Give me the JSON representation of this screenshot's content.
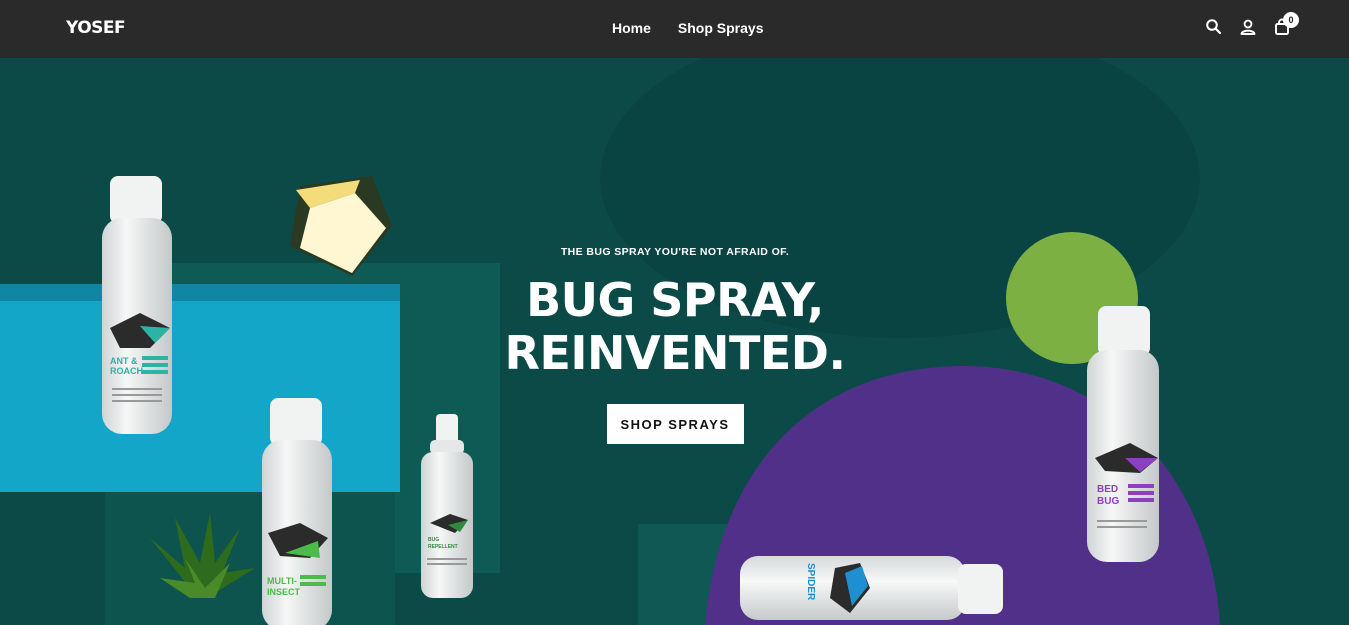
{
  "header": {
    "logo": "YOSEF",
    "nav": [
      {
        "label": "Home"
      },
      {
        "label": "Shop Sprays"
      }
    ],
    "cart_count": "0",
    "icons": [
      "search-icon",
      "account-icon",
      "cart-icon"
    ]
  },
  "hero": {
    "eyebrow": "THE BUG SPRAY YOU'RE NOT AFRAID OF.",
    "headline_line1": "BUG SPRAY,",
    "headline_line2": "REINVENTED.",
    "cta_label": "SHOP SPRAYS",
    "products": [
      {
        "label": "ANT & ROACH",
        "accent": "#2bb3a3"
      },
      {
        "label": "MULTI-INSECT",
        "accent": "#4cbb4a"
      },
      {
        "label": "BUG REPELLENT",
        "accent": "#2f8a3c"
      },
      {
        "label": "BED BUG",
        "accent": "#8e3fbf"
      },
      {
        "label": "SPIDER",
        "accent": "#1f8fd0"
      }
    ],
    "colors": {
      "background": "#0c4a48",
      "cyan_block": "#13a6c9",
      "purple_arc": "#51308a",
      "green_circle": "#7db043",
      "header_bg": "#2a2a2a"
    }
  }
}
